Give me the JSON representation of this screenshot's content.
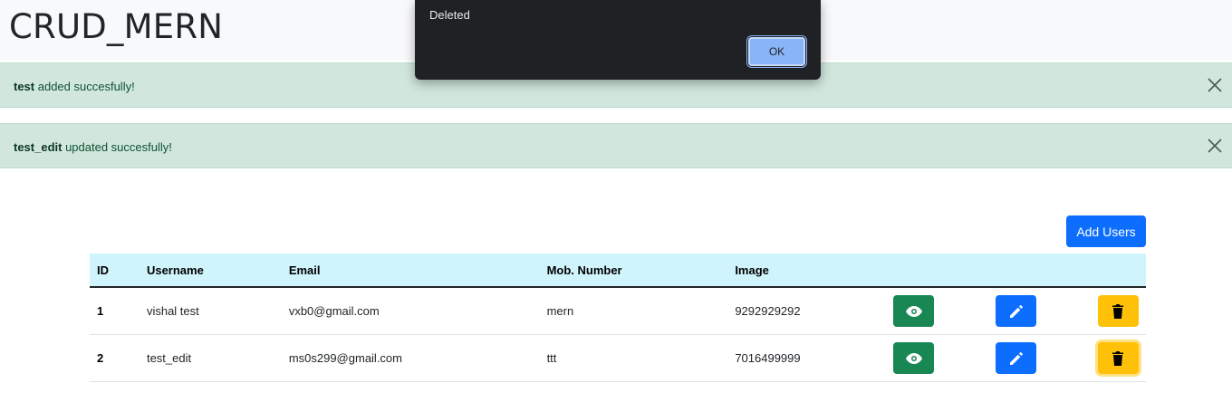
{
  "navbar": {
    "brand": "CRUD_MERN"
  },
  "alerts": [
    {
      "bold": "test",
      "text": " added succesfully!"
    },
    {
      "bold": "test_edit",
      "text": " updated succesfully!"
    }
  ],
  "add_button": "Add Users",
  "table": {
    "headers": [
      "ID",
      "Username",
      "Email",
      "Mob. Number",
      "Image",
      "",
      "",
      ""
    ],
    "rows": [
      {
        "id": "1",
        "username": "vishal test",
        "email": "vxb0@gmail.com",
        "mobile": "mern",
        "image": "9292929292"
      },
      {
        "id": "2",
        "username": "test_edit",
        "email": "ms0s299@gmail.com",
        "mobile": "ttt",
        "image": "7016499999"
      }
    ]
  },
  "dialog": {
    "message": "Deleted",
    "ok_label": "OK"
  },
  "colors": {
    "view": "#198754",
    "edit": "#0d6efd",
    "delete": "#ffc107",
    "alert_bg": "#d1e7dd",
    "header_bg": "#cff4fc"
  },
  "icons": {
    "view": "eye-icon",
    "edit": "pencil-icon",
    "delete": "trash-icon",
    "close": "close-icon"
  }
}
